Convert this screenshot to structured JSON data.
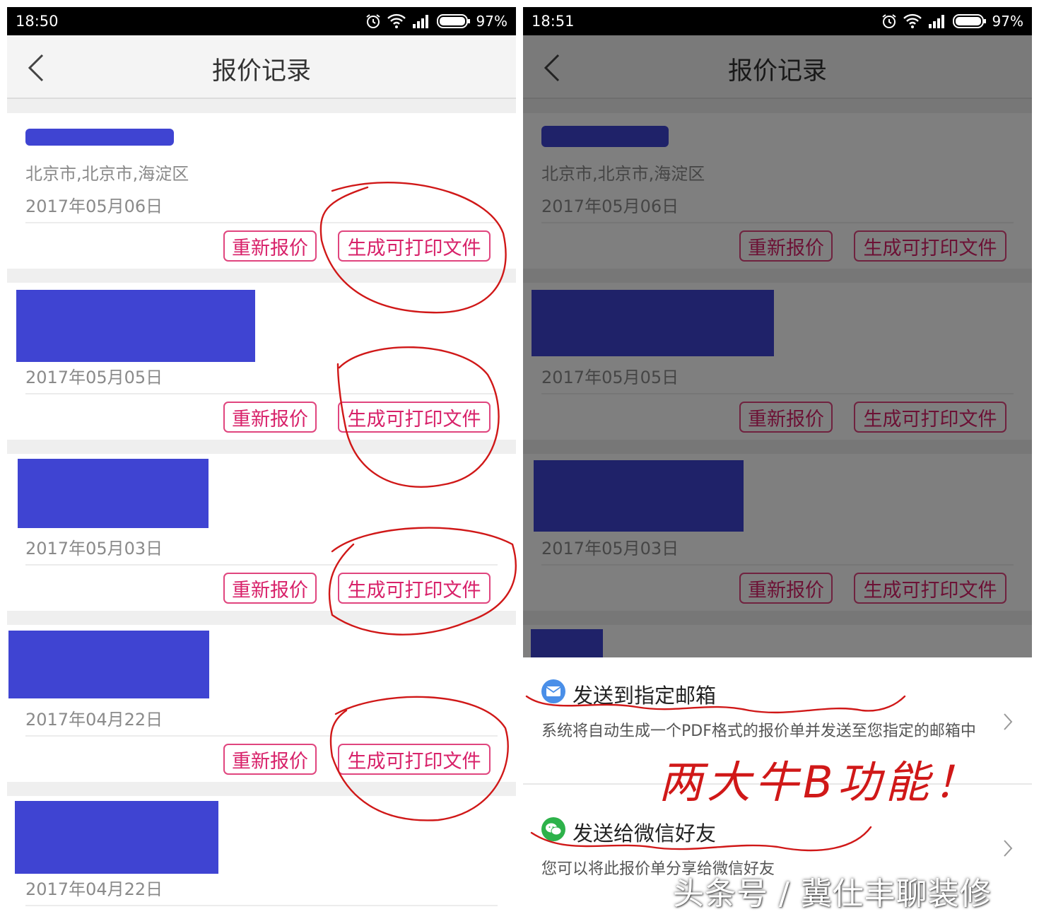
{
  "status_left": {
    "time": "18:50",
    "battery": "97%"
  },
  "status_right": {
    "time": "18:51",
    "battery": "97%"
  },
  "header": {
    "title": "报价记录"
  },
  "records": [
    {
      "address": "北京市,北京市,海淀区",
      "date": "2017年05月06日"
    },
    {
      "address": "",
      "date": "2017年05月05日"
    },
    {
      "address": "",
      "date": "2017年05月03日"
    },
    {
      "address": "",
      "date": "2017年04月22日"
    },
    {
      "address": "",
      "date": "2017年04月22日"
    }
  ],
  "actions": {
    "requote_label": "重新报价",
    "print_label": "生成可打印文件"
  },
  "share_options": [
    {
      "title": "发送到指定邮箱",
      "desc": "系统将自动生成一个PDF格式的报价单并发送至您指定的邮箱中",
      "icon": "mail-icon",
      "color": "#4a8fe8"
    },
    {
      "title": "发送给微信好友",
      "desc": "您可以将此报价单分享给微信好友",
      "icon": "wechat-icon",
      "color": "#2db24a"
    }
  ],
  "annotation_text": "两大牛B功能！",
  "watermark": "头条号 / 冀仕丰聊装修",
  "colors": {
    "accent": "#d8226a",
    "redaction": "#3f44d2",
    "annotation": "#d01818"
  }
}
